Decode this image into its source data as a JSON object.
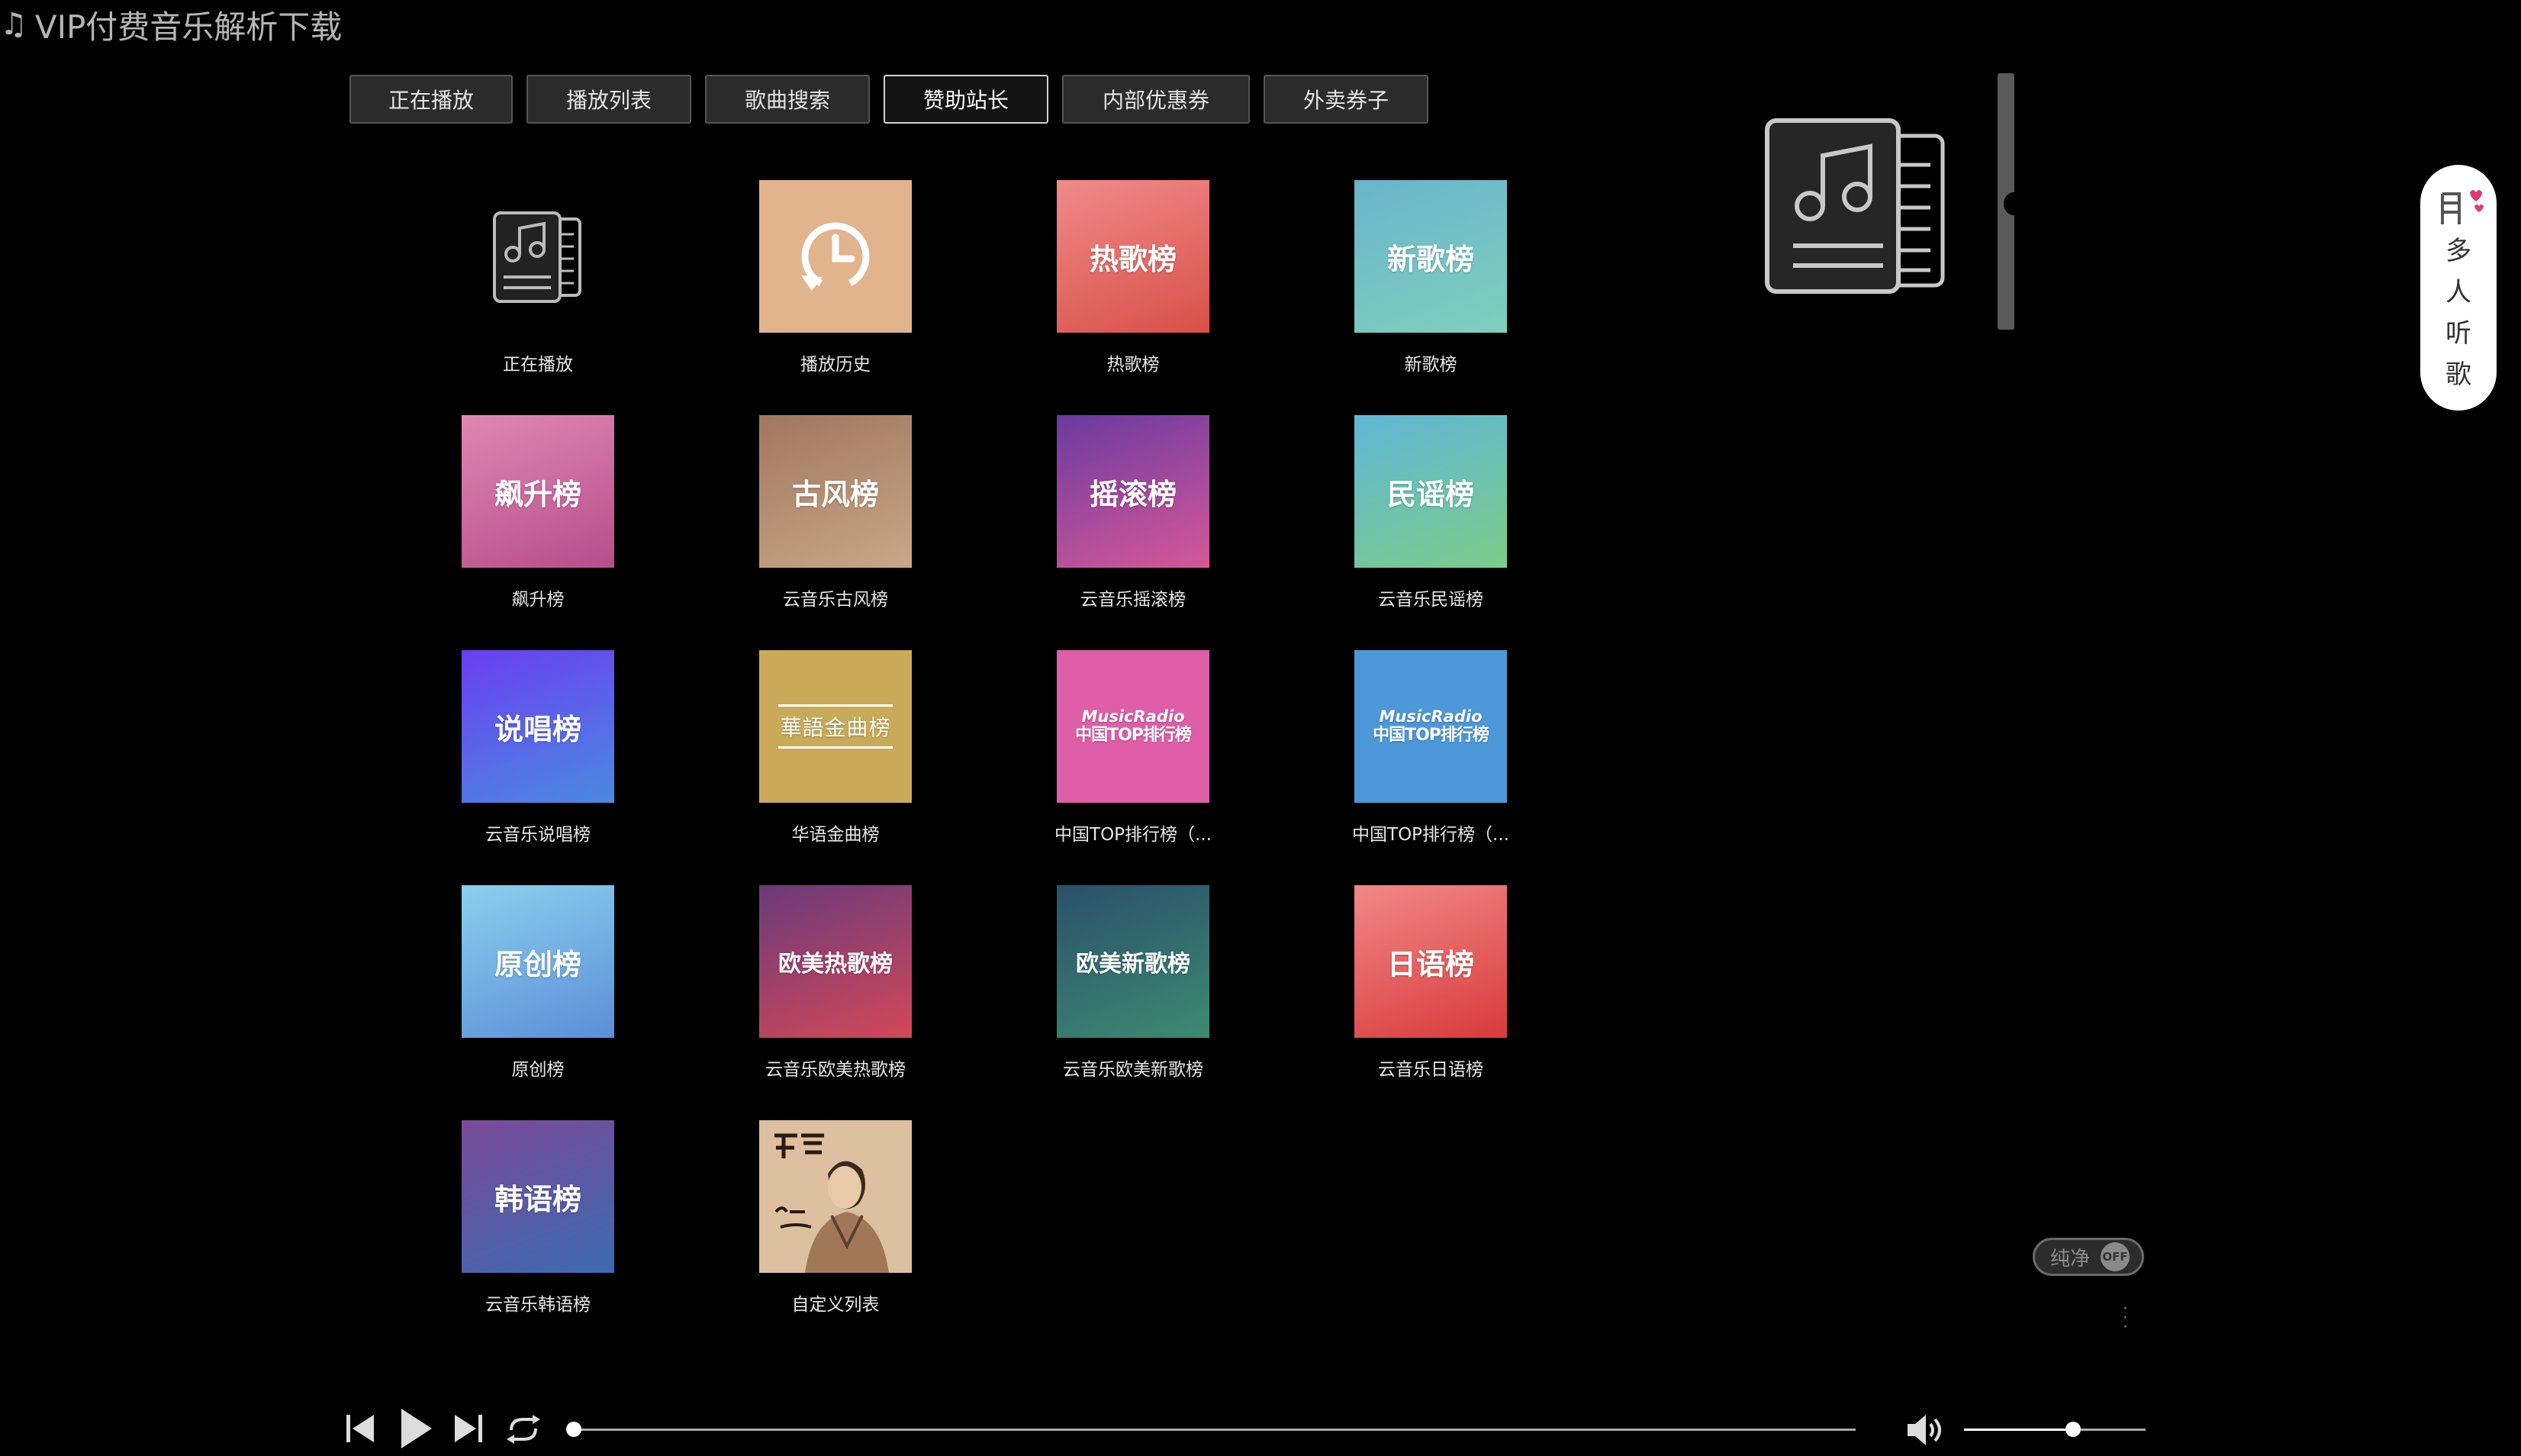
{
  "app": {
    "title": "VIP付费音乐解析下载"
  },
  "tabs": [
    {
      "label": "正在播放",
      "active": false
    },
    {
      "label": "播放列表",
      "active": false
    },
    {
      "label": "歌曲搜索",
      "active": false
    },
    {
      "label": "赞助站长",
      "active": true
    },
    {
      "label": "内部优惠券",
      "active": false
    },
    {
      "label": "外卖券子",
      "active": false
    }
  ],
  "playlists": [
    {
      "cover_text": "",
      "label": "正在播放",
      "icon": "music-doc-icon",
      "bg": "#000000"
    },
    {
      "cover_text": "",
      "label": "播放历史",
      "icon": "history-icon",
      "bg": "#e1b48e"
    },
    {
      "cover_text": "热歌榜",
      "label": "热歌榜",
      "bg": "linear-gradient(160deg,#f08a8a,#d85048)"
    },
    {
      "cover_text": "新歌榜",
      "label": "新歌榜",
      "bg": "linear-gradient(160deg,#6bb4cc,#7ed0bc)"
    },
    {
      "cover_text": "飙升榜",
      "label": "飙升榜",
      "bg": "linear-gradient(160deg,#e087b2,#b64e8c)"
    },
    {
      "cover_text": "古风榜",
      "label": "云音乐古风榜",
      "bg": "linear-gradient(160deg,#a0775f,#c9a787)"
    },
    {
      "cover_text": "摇滚榜",
      "label": "云音乐摇滚榜",
      "bg": "linear-gradient(160deg,#6a3aa0,#d65898)"
    },
    {
      "cover_text": "民谣榜",
      "label": "云音乐民谣榜",
      "bg": "linear-gradient(160deg,#5fb7d6,#7ccc8a)"
    },
    {
      "cover_text": "说唱榜",
      "label": "云音乐说唱榜",
      "bg": "linear-gradient(160deg,#6a3ef0,#4a8ae0)"
    },
    {
      "cover_text": "華語金曲榜",
      "label": "华语金曲榜",
      "icon": "huayu-logo",
      "bg": "#c9aa58"
    },
    {
      "cover_text": "MusicRadio|中国TOP排行榜",
      "label": "中国TOP排行榜（...",
      "icon": "musicradio-logo",
      "bg": "#de5fa8"
    },
    {
      "cover_text": "MusicRadio|中国TOP排行榜",
      "label": "中国TOP排行榜（...",
      "icon": "musicradio-logo",
      "bg": "#4d98d8"
    },
    {
      "cover_text": "原创榜",
      "label": "原创榜",
      "bg": "linear-gradient(160deg,#8ccfee,#5b8fd8)"
    },
    {
      "cover_text": "欧美热歌榜",
      "label": "云音乐欧美热歌榜",
      "bg": "linear-gradient(160deg,#6b3a7a,#d24858)"
    },
    {
      "cover_text": "欧美新歌榜",
      "label": "云音乐欧美新歌榜",
      "bg": "linear-gradient(160deg,#2a506a,#3e8a72)"
    },
    {
      "cover_text": "日语榜",
      "label": "云音乐日语榜",
      "bg": "linear-gradient(160deg,#f28888,#d83a3a)"
    },
    {
      "cover_text": "韩语榜",
      "label": "云音乐韩语榜",
      "bg": "linear-gradient(160deg,#7a4a9a,#3c6ab0)"
    },
    {
      "cover_text": "",
      "label": "自定义列表",
      "icon": "artist-photo",
      "bg": "#d8b998"
    }
  ],
  "multi_listen": {
    "chars": [
      "多",
      "人",
      "听",
      "歌"
    ]
  },
  "pure_toggle": {
    "label": "纯净",
    "state": "OFF"
  },
  "player": {
    "progress": 0.0,
    "volume": 0.6,
    "icons": [
      "prev-icon",
      "play-icon",
      "next-icon",
      "loop-icon",
      "volume-icon"
    ]
  }
}
